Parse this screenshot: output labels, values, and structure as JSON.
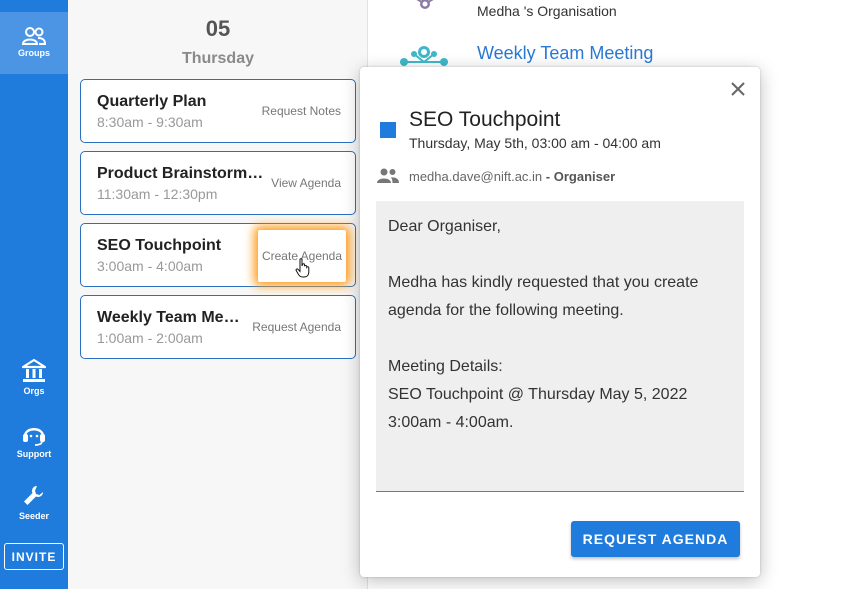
{
  "sidebar": {
    "groups_label": "Groups",
    "orgs_label": "Orgs",
    "support_label": "Support",
    "seeder_label": "Seeder",
    "invite_label": "INVITE"
  },
  "day": {
    "number": "05",
    "name": "Thursday"
  },
  "meetings": [
    {
      "title": "Quarterly Plan",
      "time": "8:30am - 9:30am",
      "action": "Request Notes"
    },
    {
      "title": "Product Brainstorming",
      "time": "11:30am - 12:30pm",
      "action": "View Agenda"
    },
    {
      "title": "SEO Touchpoint",
      "time": "3:00am - 4:00am",
      "action": "Create Agenda"
    },
    {
      "title": "Weekly Team Meeting",
      "time": "1:00am - 2:00am",
      "action": "Request Agenda"
    }
  ],
  "right": {
    "org_name": "Medha 's Organisation",
    "meeting_title": "Weekly Team Meeting"
  },
  "popup": {
    "title": "SEO Touchpoint",
    "datetime": "Thursday, May 5th, 03:00 am - 04:00 am",
    "email": "medha.dave@nift.ac.in",
    "role": "- Organiser",
    "message": {
      "greeting": "Dear Organiser,",
      "line1": "Medha has kindly requested that you create",
      "line2": "agenda for the following meeting.",
      "details_label": "Meeting Details:",
      "details_line1": "SEO Touchpoint @ Thursday May 5, 2022",
      "details_line2": "3:00am - 4:00am."
    },
    "button_label": "REQUEST AGENDA",
    "accent_color": "#1f7bdc"
  }
}
